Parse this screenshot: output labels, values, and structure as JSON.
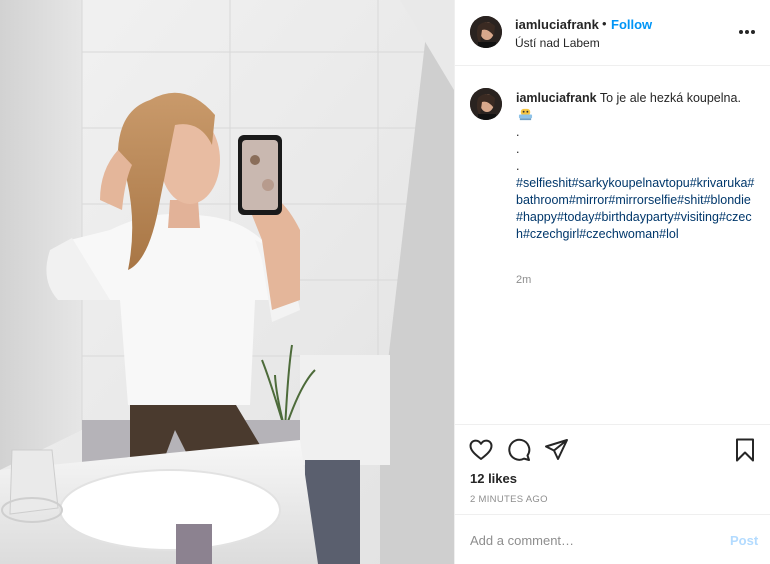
{
  "post": {
    "author": {
      "username": "iamluciafrank",
      "separator": "•",
      "follow_label": "Follow",
      "location": "Ústí nad Labem",
      "avatar_icon": "profile-avatar",
      "more_icon": "more-horizontal-icon"
    },
    "caption": {
      "username": "iamluciafrank",
      "text": "To je ale hezká koupelna.",
      "emoji_icon": "bathtub-emoji-icon",
      "dots": [
        ".",
        ".",
        "."
      ],
      "hashtags": [
        "#selfieshit",
        "#sarkykoupelnavtopu",
        "#krivaruka",
        "#bathroom",
        "#mirror",
        "#mirrorselfie",
        "#shit",
        "#blondie",
        "#happy",
        "#today",
        "#birthdayparty",
        "#visiting",
        "#czech",
        "#czechgirl",
        "#czechwoman",
        "#lol"
      ],
      "time": "2m"
    },
    "actions": {
      "like_icon": "heart-icon",
      "comment_icon": "comment-bubble-icon",
      "share_icon": "paper-plane-icon",
      "save_icon": "bookmark-icon"
    },
    "likes": "12 likes",
    "posted_ago": "2 minutes ago",
    "comment_box": {
      "placeholder": "Add a comment…",
      "post_label": "Post"
    },
    "colors": {
      "link_blue": "#0095f6",
      "hashtag_blue": "#00376b",
      "muted": "#8e8e8e",
      "post_disabled": "#b3dbff",
      "divider": "#efefef"
    }
  }
}
